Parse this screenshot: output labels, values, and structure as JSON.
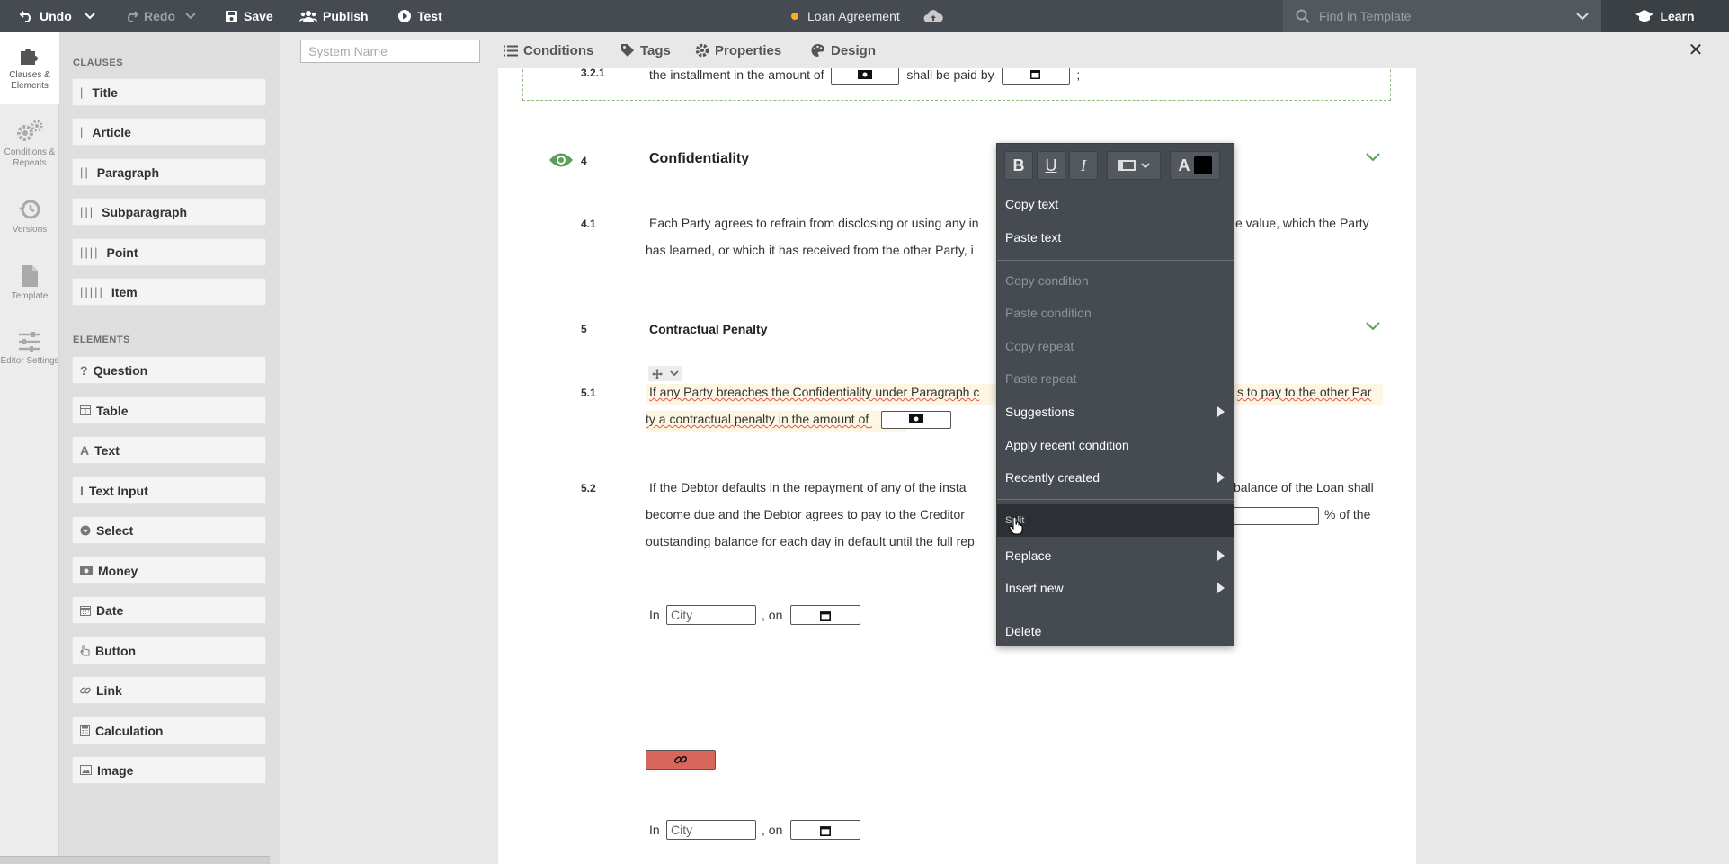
{
  "toolbar": {
    "undo": "Undo",
    "redo": "Redo",
    "save": "Save",
    "publish": "Publish",
    "test": "Test",
    "doc_title": "Loan Agreement",
    "find_placeholder": "Find in Template",
    "learn": "Learn"
  },
  "rail": [
    {
      "label": "Clauses & Elements",
      "icon": "puzzle-icon"
    },
    {
      "label": "Conditions & Repeats",
      "icon": "gears-icon"
    },
    {
      "label": "Versions",
      "icon": "history-icon"
    },
    {
      "label": "Template",
      "icon": "file-icon"
    },
    {
      "label": "Editor Settings",
      "icon": "sliders-icon"
    }
  ],
  "panel": {
    "clauses_title": "CLAUSES",
    "clauses": [
      {
        "label": "Title",
        "bars": "|"
      },
      {
        "label": "Article",
        "bars": "|"
      },
      {
        "label": "Paragraph",
        "bars": "||"
      },
      {
        "label": "Subparagraph",
        "bars": "|||"
      },
      {
        "label": "Point",
        "bars": "||||"
      },
      {
        "label": "Item",
        "bars": "|||||"
      }
    ],
    "elements_title": "ELEMENTS",
    "elements": [
      {
        "label": "Question",
        "icon": "question-icon"
      },
      {
        "label": "Table",
        "icon": "table-icon"
      },
      {
        "label": "Text",
        "icon": "text-icon"
      },
      {
        "label": "Text Input",
        "icon": "text-cursor-icon"
      },
      {
        "label": "Select",
        "icon": "select-icon"
      },
      {
        "label": "Money",
        "icon": "money-icon"
      },
      {
        "label": "Date",
        "icon": "calendar-icon"
      },
      {
        "label": "Button",
        "icon": "pointer-icon"
      },
      {
        "label": "Link",
        "icon": "link-icon"
      },
      {
        "label": "Calculation",
        "icon": "calculator-icon"
      },
      {
        "label": "Image",
        "icon": "image-icon"
      }
    ]
  },
  "subbar": {
    "system_name_placeholder": "System Name",
    "conditions": "Conditions",
    "tags": "Tags",
    "properties": "Properties",
    "design": "Design"
  },
  "document": {
    "n321": "3.2.1",
    "t321a": "the installment in the amount of",
    "t321b": "shall be paid by",
    "t321c": ";",
    "n4": "4",
    "h4": "Confidentiality",
    "n41": "4.1",
    "t41_line1a": "Each Party agrees to refrain from disclosing or using any in",
    "t41_line1b": "e value, which the Party",
    "t41_line2": "has learned, or which it has received from the other Party, i",
    "n5": "5",
    "h5": "Contractual Penalty",
    "n51": "5.1",
    "t51_line1a": "If any Party breaches the Confidentiality under Paragraph c",
    "t51_line1b": "s to pay to the other Par",
    "t51_line2": "ty a contractual penalty in the amount of",
    "n52": "5.2",
    "t52_line1a": "If the Debtor defaults in the repayment   of any of the insta",
    "t52_line1b": "balance of the Loan shall",
    "t52_line2a": "become due and   the Debtor agrees to pay to the Creditor",
    "t52_line2b": "% of the",
    "t52_line3": "outstanding balance for each day in default until the full rep",
    "in1": "In",
    "city1": "City",
    "on1": ", on",
    "signature_line": "___________________",
    "in2": "In",
    "city2": "City",
    "on2": ", on"
  },
  "context_menu": {
    "bold": "B",
    "underline": "U",
    "italic": "I",
    "color_a": "A",
    "items": {
      "copy_text": "Copy text",
      "paste_text": "Paste text",
      "copy_condition": "Copy condition",
      "paste_condition": "Paste condition",
      "copy_repeat": "Copy repeat",
      "paste_repeat": "Paste repeat",
      "suggestions": "Suggestions",
      "apply_recent_condition": "Apply recent condition",
      "recently_created": "Recently created",
      "split": "Split",
      "replace": "Replace",
      "insert_new": "Insert new",
      "delete": "Delete"
    }
  },
  "colors": {
    "toolbar_bg": "#464b51",
    "menu_bg": "#454b51",
    "accent_green": "#5aa05a",
    "link_button": "#d9665a",
    "unsaved_dot": "#f5b21b"
  }
}
